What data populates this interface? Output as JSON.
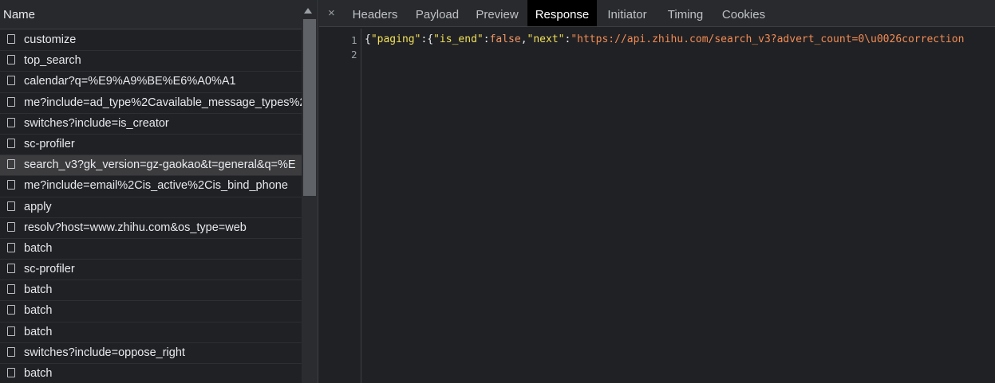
{
  "list": {
    "header": "Name",
    "rows": [
      "customize",
      "top_search",
      "calendar?q=%E9%A9%BE%E6%A0%A1",
      "me?include=ad_type%2Cavailable_message_types%2",
      "switches?include=is_creator",
      "sc-profiler",
      "search_v3?gk_version=gz-gaokao&t=general&q=%E",
      "me?include=email%2Cis_active%2Cis_bind_phone",
      "apply",
      "resolv?host=www.zhihu.com&os_type=web",
      "batch",
      "sc-profiler",
      "batch",
      "batch",
      "batch",
      "switches?include=oppose_right",
      "batch"
    ]
  },
  "tabs": {
    "items": [
      "Headers",
      "Payload",
      "Preview",
      "Response",
      "Initiator",
      "Timing",
      "Cookies"
    ],
    "active": "Response",
    "close_glyph": "×"
  },
  "code": {
    "line_numbers": [
      "1",
      "2"
    ],
    "open_brace": "{",
    "key1": "\"paging\"",
    "colon": ":",
    "brace2": "{",
    "key2": "\"is_end\"",
    "val_false": "false",
    "comma": ",",
    "key3": "\"next\"",
    "url_str": "\"https://api.zhihu.com/search_v3?advert_count=0\\u0026correction"
  },
  "colors": {
    "key": "#f1e05a",
    "keyword": "#f29766",
    "string": "#f28b54",
    "active_tab_bg": "#000000"
  }
}
